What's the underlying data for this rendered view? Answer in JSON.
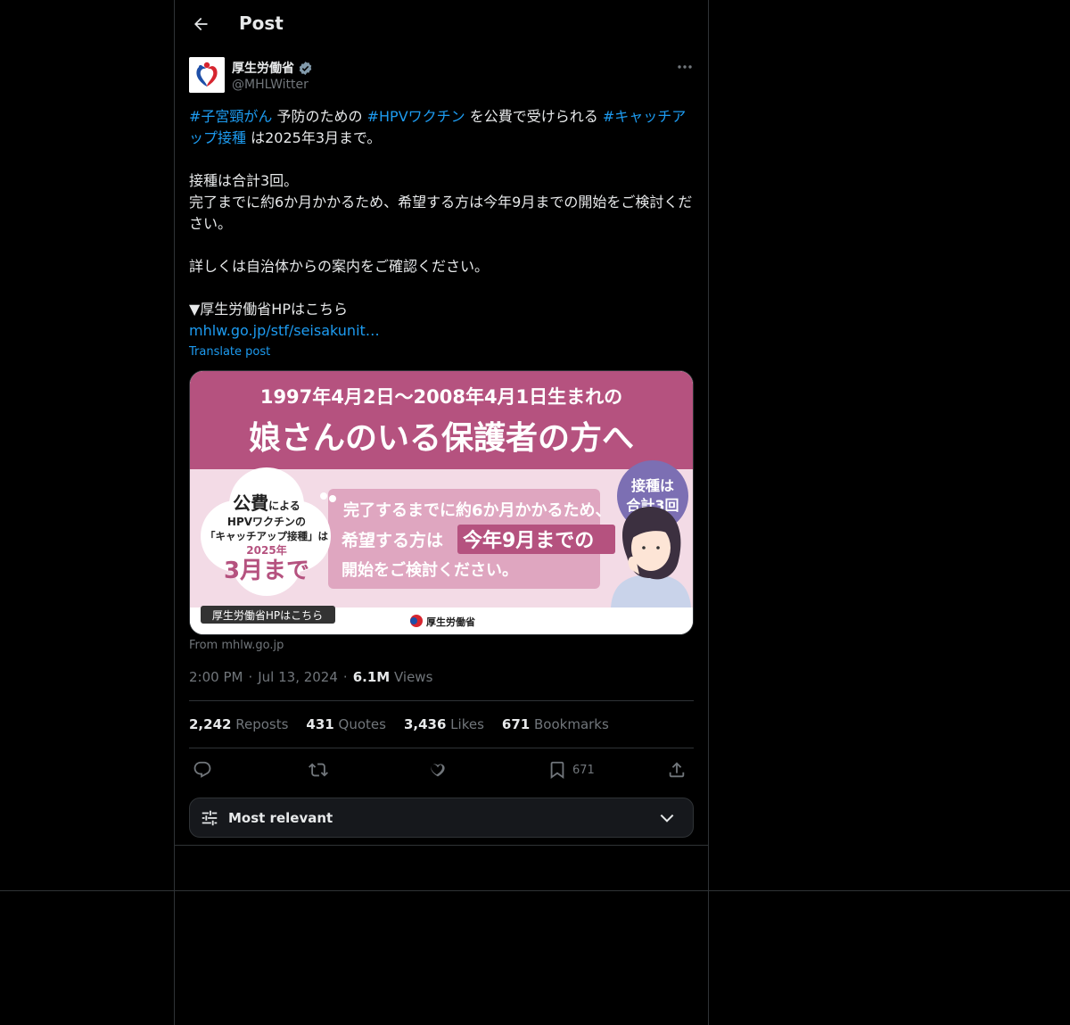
{
  "header": {
    "title": "Post"
  },
  "author": {
    "name": "厚生労働省",
    "handle": "@MHLWitter"
  },
  "tweet": {
    "tag1": "#子宮頸がん",
    "seg1": " 予防のための ",
    "tag2": "#HPVワクチン",
    "seg2": " を公費で受けられる ",
    "tag3": "#キャッチアップ接種",
    "seg3": " は2025年3月まで。",
    "line2": "接種は合計3回。",
    "line3": "完了までに約6か月かかるため、希望する方は今年9月までの開始をご検討ください。",
    "line4": "詳しくは自治体からの案内をご確認ください。",
    "line5": "▼厚生労働省HPはこちら",
    "link": "mhlw.go.jp/stf/seisakunit…"
  },
  "translate": "Translate post",
  "card": {
    "title_line1": "1997年4月2日〜2008年4月1日生まれの",
    "title_line2": "娘さんのいる保護者の方へ",
    "bubble_l1": "公費",
    "bubble_l1b": "による",
    "bubble_l2": "HPVワクチンの",
    "bubble_l3": "「キャッチアップ接種」は",
    "bubble_l4": "2025年",
    "bubble_l5": "3月まで",
    "msg_l1": "完了するまでに約6か月かかるため、",
    "msg_l2a": "希望する方は",
    "msg_l2b": "今年9月までの",
    "msg_l3": "開始をご検討ください。",
    "badge_l1": "接種は",
    "badge_l2": "合計3回",
    "footer_tag": "厚生労働省HPはこちら",
    "footer_logo": "厚生労働省"
  },
  "from": "From mhlw.go.jp",
  "meta": {
    "time": "2:00 PM",
    "dot1": "·",
    "date": "Jul 13, 2024",
    "dot2": "·",
    "views_count": "6.1M",
    "views_label": "Views"
  },
  "stats": {
    "reposts_count": "2,242",
    "reposts_label": "Reposts",
    "quotes_count": "431",
    "quotes_label": "Quotes",
    "likes_count": "3,436",
    "likes_label": "Likes",
    "bookmarks_count": "671",
    "bookmarks_label": "Bookmarks"
  },
  "actions": {
    "bookmark_count": "671"
  },
  "sort": {
    "label": "Most relevant"
  },
  "colors": {
    "accent": "#1d9bf0",
    "card_pink": "#b5527f",
    "card_light": "#dfa6c0"
  },
  "icons": [
    "back-arrow-icon",
    "verified-badge-icon",
    "more-icon",
    "reply-icon",
    "repost-icon",
    "like-icon",
    "bookmark-icon",
    "share-icon",
    "sliders-icon",
    "chevron-down-icon"
  ]
}
